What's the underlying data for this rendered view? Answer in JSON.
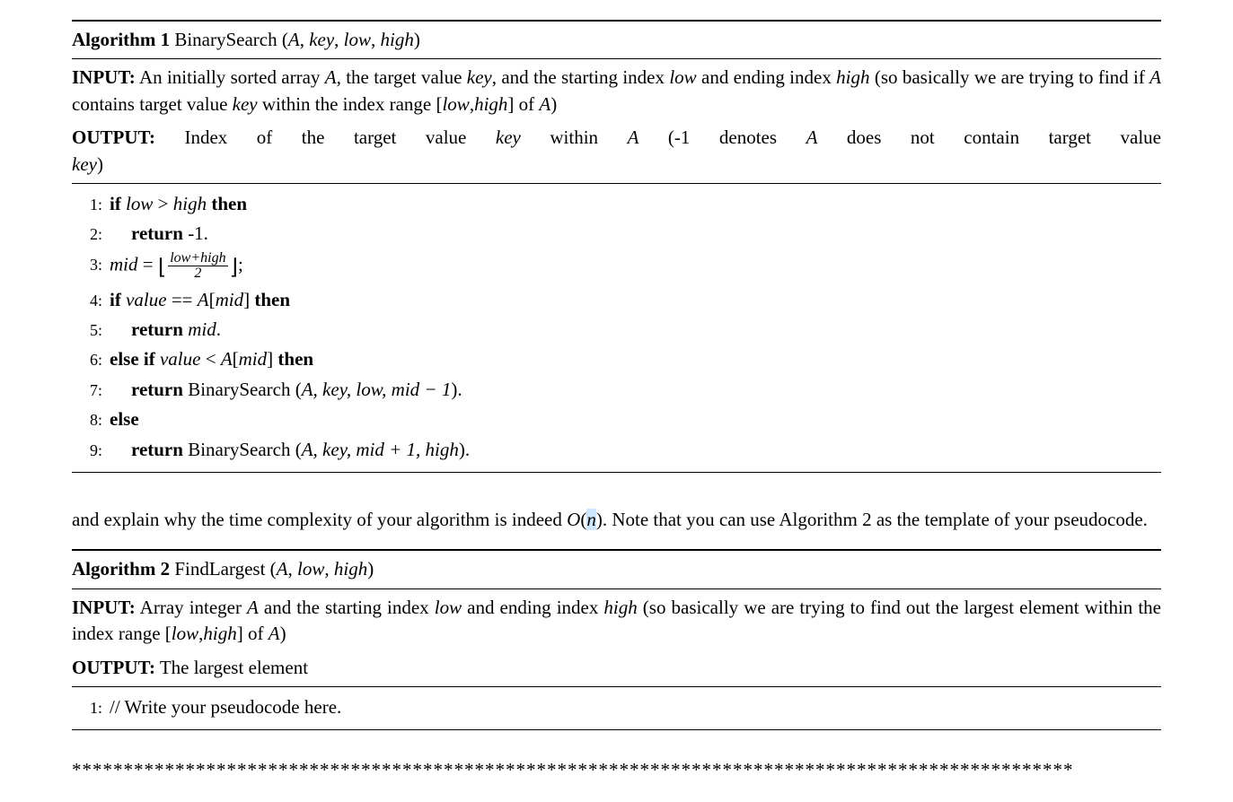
{
  "algo1": {
    "label": "Algorithm 1",
    "name": "BinarySearch",
    "params": "A, key, low, high",
    "input_label": "INPUT:",
    "input_text_1": " An initially sorted array ",
    "input_A": "A",
    "input_text_2": ", the target value ",
    "input_key": "key",
    "input_text_3": ", and the starting index ",
    "input_low": "low",
    "input_text_4": " and ending index ",
    "input_high": "high",
    "input_text_5": " (so basically we are trying to find if ",
    "input_text_6": " contains target value ",
    "input_text_7": " within the index range [",
    "input_text_8": "] of ",
    "input_text_9": ")",
    "output_label": "OUTPUT:",
    "output_text_1": " Index of the target value ",
    "output_text_2": " within ",
    "output_text_3": " (-1 denotes ",
    "output_text_4": " does not contain target value ",
    "output_text_5": ")",
    "steps": {
      "n1": "1:",
      "n2": "2:",
      "n3": "3:",
      "n4": "4:",
      "n5": "5:",
      "n6": "6:",
      "n7": "7:",
      "n8": "8:",
      "n9": "9:",
      "s1_if": "if ",
      "s1_cond_a": "low",
      "s1_gt": " > ",
      "s1_cond_b": "high",
      "s1_then": " then",
      "s2_return": "return ",
      "s2_val": " -1.",
      "s3_mid": "mid",
      "s3_eq": " = ",
      "s3_num": "low+high",
      "s3_den": "2",
      "s3_semi": ";",
      "s4_if": "if ",
      "s4_val": "value",
      "s4_eqeq": " == ",
      "s4_A": "A",
      "s4_br_l": "[",
      "s4_mid": "mid",
      "s4_br_r": "]",
      "s4_then": " then",
      "s5_return": "return ",
      "s5_mid": " mid",
      "s5_dot": ".",
      "s6_elseif": "else if ",
      "s6_val": "value",
      "s6_lt": " < ",
      "s6_then": " then",
      "s7_return": "return ",
      "s7_call": " BinarySearch (",
      "s7_args": "A, key, low, mid − 1",
      "s7_close": ").",
      "s8_else": "else",
      "s9_return": "return ",
      "s9_call": " BinarySearch (",
      "s9_args": "A, key, mid + 1, high",
      "s9_close": ")."
    }
  },
  "paragraph": {
    "text_1": "and explain why the time complexity of your algorithm is indeed ",
    "O": "O",
    "lp": "(",
    "n": "n",
    "rp": ")",
    "text_2": ". Note that you can use Algorithm 2 as the template of your pseudocode."
  },
  "algo2": {
    "label": "Algorithm 2",
    "name": "FindLargest",
    "params": "A, low, high",
    "input_label": "INPUT:",
    "input_text_1": " Array integer ",
    "input_A": "A",
    "input_text_2": " and the starting index ",
    "input_low": "low",
    "input_text_3": " and ending index ",
    "input_high": "high",
    "input_text_4": " (so basically we are trying to find out the largest element within the index range [",
    "input_text_5": "] of ",
    "input_text_6": ")",
    "output_label": "OUTPUT:",
    "output_text": " The largest element",
    "steps": {
      "n1": "1:",
      "s1": "// Write your pseudocode here."
    }
  },
  "stars": "*************************************************************************************************"
}
